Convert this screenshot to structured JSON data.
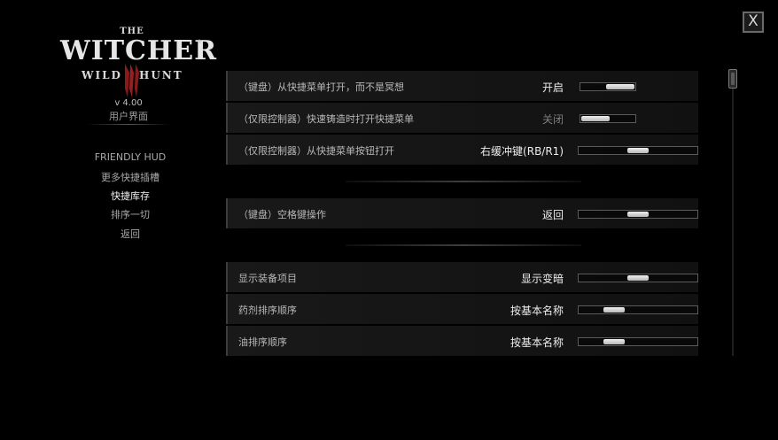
{
  "window": {
    "close_label": "X"
  },
  "logo": {
    "the": "THE",
    "main": "WITCHER",
    "tm": "®",
    "sub_left": "WILD",
    "sub_right": "HUNT",
    "emblem_icon": "wolf-claw-III-emblem",
    "emblem_color": "#8b1a1a"
  },
  "version": "v 4.00",
  "subtitle": "用户界面",
  "nav": {
    "items": [
      {
        "label": "FRIENDLY HUD",
        "active": false
      },
      {
        "label": "更多快捷插槽",
        "active": false
      },
      {
        "label": "快捷库存",
        "active": true
      },
      {
        "label": "排序一切",
        "active": false
      },
      {
        "label": "返回",
        "active": false
      }
    ]
  },
  "settings": {
    "group1": [
      {
        "label": "（键盘）从快捷菜单打开，而不是冥想",
        "value": "开启",
        "dim": false,
        "slider_level": 1.0
      },
      {
        "label": "（仅限控制器）快速铸造时打开快捷菜单",
        "value": "关闭",
        "dim": true,
        "slider_level": 0.0
      },
      {
        "label": "（仅限控制器）从快捷菜单按钮打开",
        "value": "右缓冲键(RB/R1)",
        "dim": false,
        "slider_level": 0.5
      }
    ],
    "group2": [
      {
        "label": "（键盘）空格键操作",
        "value": "返回",
        "dim": false,
        "slider_level": 0.5
      }
    ],
    "group3": [
      {
        "label": "显示装备项目",
        "value": "显示变暗",
        "dim": false,
        "slider_level": 0.5
      },
      {
        "label": "药剂排序顺序",
        "value": "按基本名称",
        "dim": false,
        "slider_level": 0.25
      },
      {
        "label": "油排序顺序",
        "value": "按基本名称",
        "dim": false,
        "slider_level": 0.25
      }
    ]
  },
  "scroll": {
    "position": 0.0
  },
  "colors": {
    "background": "#000000",
    "text_active": "#f1f1f1",
    "text_dim": "#7e7e7e"
  }
}
